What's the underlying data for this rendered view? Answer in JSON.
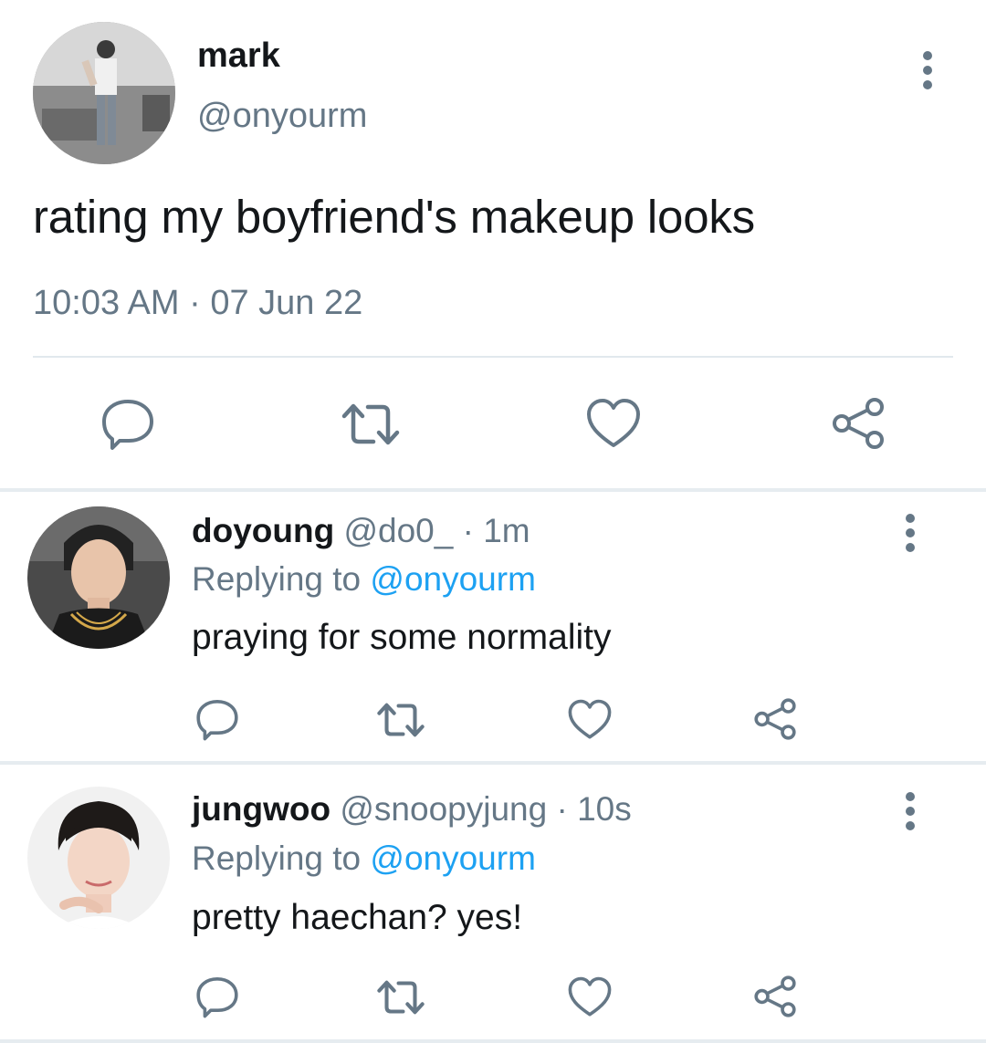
{
  "main_tweet": {
    "author_name": "mark",
    "author_handle": "@onyourm",
    "text": "rating my boyfriend's makeup looks",
    "time": "10:03 AM",
    "date": "07 Jun 22",
    "separator": " · "
  },
  "replies": [
    {
      "author_name": "doyoung",
      "author_handle": "@do0_",
      "age": "1m",
      "replying_label": "Replying to",
      "replying_to": "@onyourm",
      "text": "praying for some normality"
    },
    {
      "author_name": "jungwoo",
      "author_handle": "@snoopyjung",
      "age": "10s",
      "replying_label": "Replying to",
      "replying_to": "@onyourm",
      "text": "pretty haechan? yes!"
    }
  ],
  "icons": {
    "reply": "reply-icon",
    "retweet": "retweet-icon",
    "like": "heart-icon",
    "share": "share-icon",
    "more": "more-icon"
  },
  "colors": {
    "text_primary": "#14171a",
    "text_secondary": "#657786",
    "mention": "#1da1f2",
    "divider": "#e1e8ed"
  }
}
